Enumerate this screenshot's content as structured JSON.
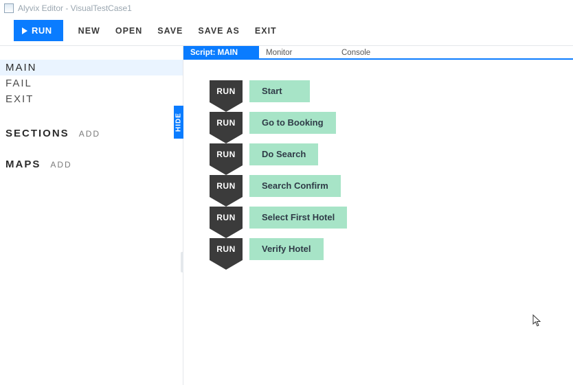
{
  "window": {
    "title": "Alyvix Editor - VisualTestCase1"
  },
  "toolbar": {
    "run": "RUN",
    "new": "NEW",
    "open": "OPEN",
    "save": "SAVE",
    "saveas": "SAVE AS",
    "exit": "EXIT"
  },
  "sidebar": {
    "scripts": [
      {
        "label": "MAIN",
        "selected": true
      },
      {
        "label": "FAIL",
        "selected": false
      },
      {
        "label": "EXIT",
        "selected": false
      }
    ],
    "sections_label": "SECTIONS",
    "maps_label": "MAPS",
    "add_label": "ADD"
  },
  "tabs": {
    "script": "Script: MAIN",
    "monitor": "Monitor",
    "console": "Console"
  },
  "hide_label": "HIDE",
  "flow": {
    "tag": "RUN",
    "steps": [
      "Start",
      "Go to Booking",
      "Do Search",
      "Search Confirm",
      "Select First Hotel",
      "Verify Hotel"
    ]
  }
}
